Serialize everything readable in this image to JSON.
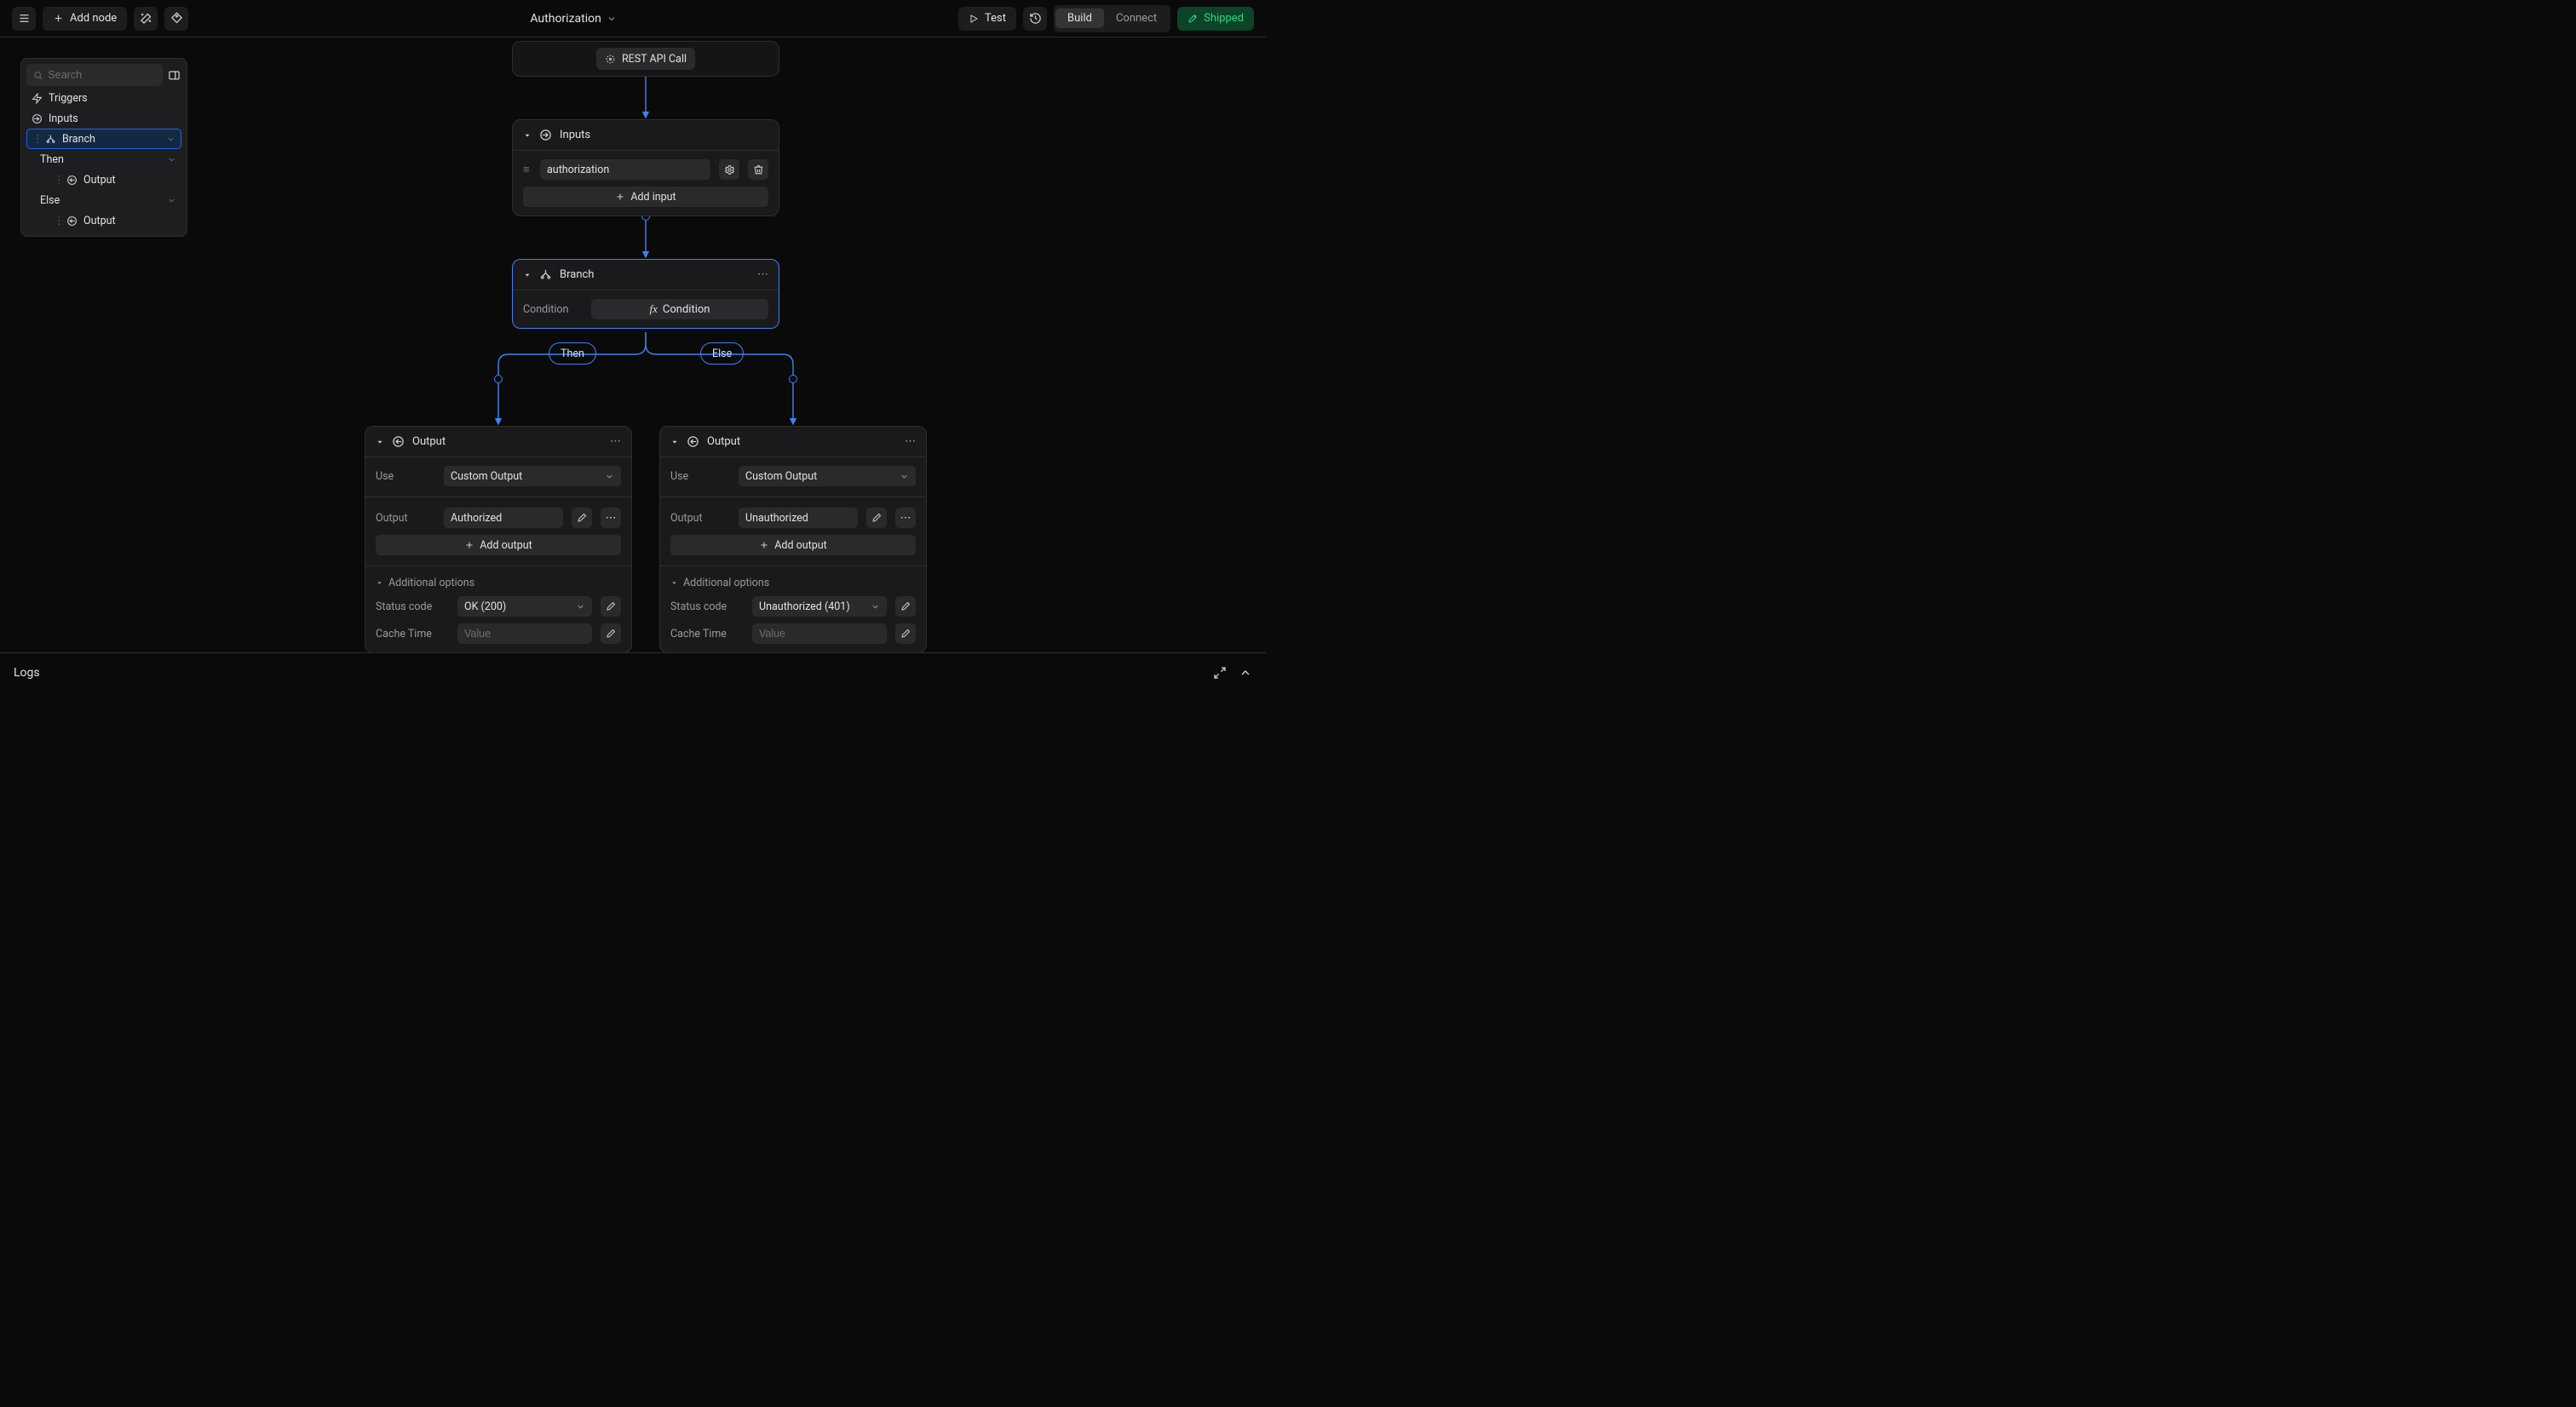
{
  "header": {
    "add_node": "Add node",
    "title": "Authorization",
    "test": "Test",
    "build": "Build",
    "connect": "Connect",
    "shipped": "Shipped"
  },
  "tree": {
    "search_placeholder": "Search",
    "items": [
      {
        "label": "Triggers"
      },
      {
        "label": "Inputs"
      },
      {
        "label": "Branch"
      },
      {
        "label": "Then"
      },
      {
        "label": "Output"
      },
      {
        "label": "Else"
      },
      {
        "label": "Output"
      }
    ]
  },
  "rest_call": {
    "label": "REST API Call"
  },
  "inputs_node": {
    "title": "Inputs",
    "input_name": "authorization",
    "add_input": "Add input"
  },
  "branch_node": {
    "title": "Branch",
    "condition_label": "Condition",
    "condition_btn": "Condition"
  },
  "branch_labels": {
    "then": "Then",
    "else": "Else"
  },
  "output_left": {
    "title": "Output",
    "use_label": "Use",
    "use_value": "Custom Output",
    "output_label": "Output",
    "output_value": "Authorized",
    "add_output": "Add output",
    "additional": "Additional options",
    "status_label": "Status code",
    "status_value": "OK (200)",
    "cache_label": "Cache Time",
    "cache_placeholder": "Value"
  },
  "output_right": {
    "title": "Output",
    "use_label": "Use",
    "use_value": "Custom Output",
    "output_label": "Output",
    "output_value": "Unauthorized",
    "add_output": "Add output",
    "additional": "Additional options",
    "status_label": "Status code",
    "status_value": "Unauthorized (401)",
    "cache_label": "Cache Time",
    "cache_placeholder": "Value"
  },
  "logs": {
    "label": "Logs"
  }
}
